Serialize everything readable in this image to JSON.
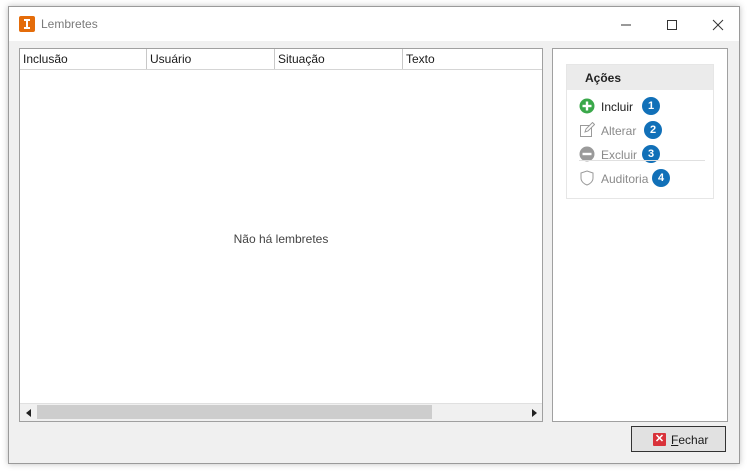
{
  "window": {
    "title": "Lembretes",
    "controls": {
      "minimize": "—",
      "maximize": "☐",
      "close": "✕"
    }
  },
  "grid": {
    "columns": [
      "Inclusão",
      "Usuário",
      "Situação",
      "Texto"
    ],
    "empty_message": "Não há lembretes"
  },
  "actions": {
    "title": "Ações",
    "items": [
      {
        "label": "Incluir",
        "badge": "1",
        "enabled": true,
        "icon": "add-circle-icon",
        "icon_color": "#3aa84a"
      },
      {
        "label": "Alterar",
        "badge": "2",
        "enabled": false,
        "icon": "edit-icon",
        "icon_color": "#9a9a9a"
      },
      {
        "label": "Excluir",
        "badge": "3",
        "enabled": false,
        "icon": "remove-circle-icon",
        "icon_color": "#9a9a9a"
      },
      {
        "label": "Auditoria",
        "badge": "4",
        "enabled": false,
        "icon": "shield-icon",
        "icon_color": "#9a9a9a"
      }
    ]
  },
  "footer": {
    "close_label_first": "F",
    "close_label_rest": "echar"
  },
  "colors": {
    "app_icon": "#e46c0a",
    "badge": "#1170b8",
    "close_icon": "#d9323a"
  }
}
